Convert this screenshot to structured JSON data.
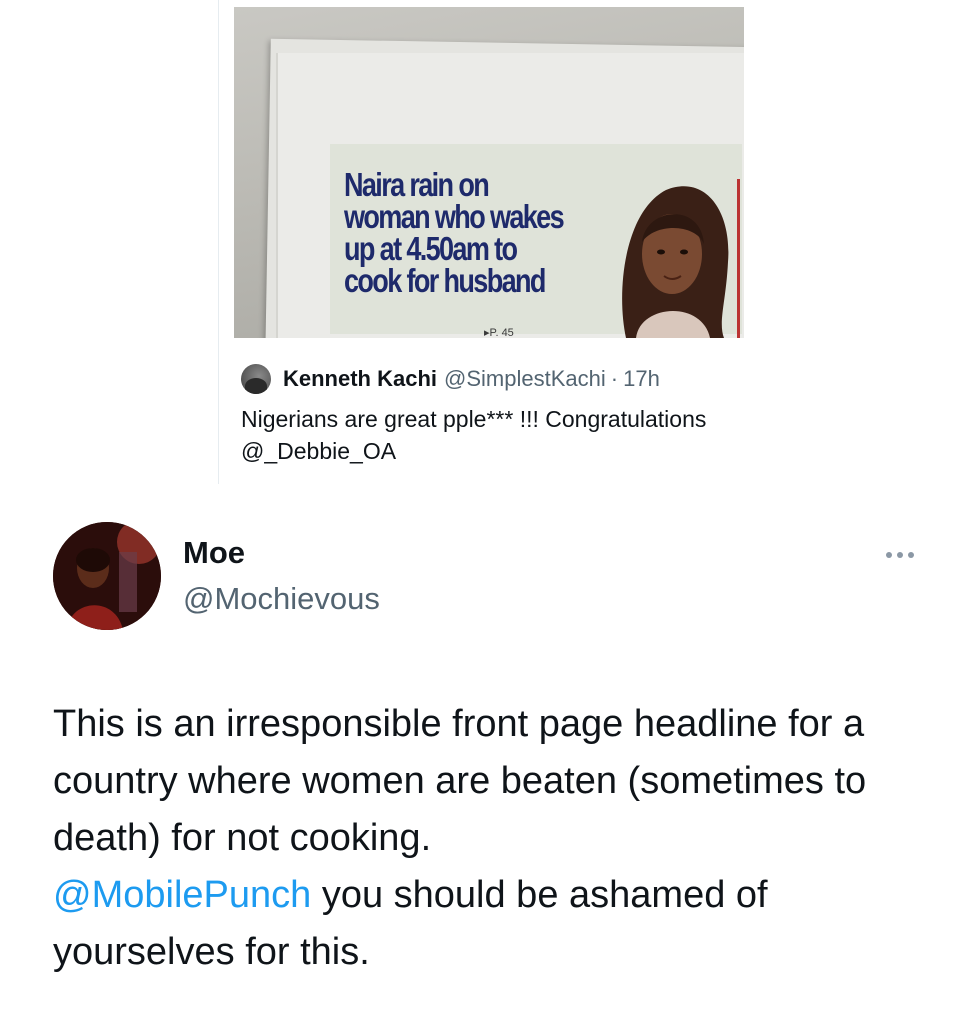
{
  "quote": {
    "image": {
      "headline": [
        "Naira rain on",
        "woman who wakes",
        "up at 4.50am to",
        "cook for husband"
      ],
      "page_ref": "P. 45"
    },
    "author_name": "Kenneth Kachi",
    "author_handle": "@SimplestKachi",
    "separator": "·",
    "time": "17h",
    "text_line1": "Nigerians are great pple*** !!! Congratulations",
    "mention": "@_Debbie_OA"
  },
  "tweet": {
    "author_name": "Moe",
    "author_handle": "@Mochievous",
    "more_icon": "ellipsis-icon",
    "text_before": "This is an irresponsible front page headline for a country where women are beaten (sometimes to death) for not cooking.",
    "mention": "@MobilePunch",
    "text_after": " you should be ashamed of yourselves for this.",
    "colors": {
      "link": "#1d9bf0",
      "secondary": "#536471",
      "text": "#0f1419"
    }
  }
}
